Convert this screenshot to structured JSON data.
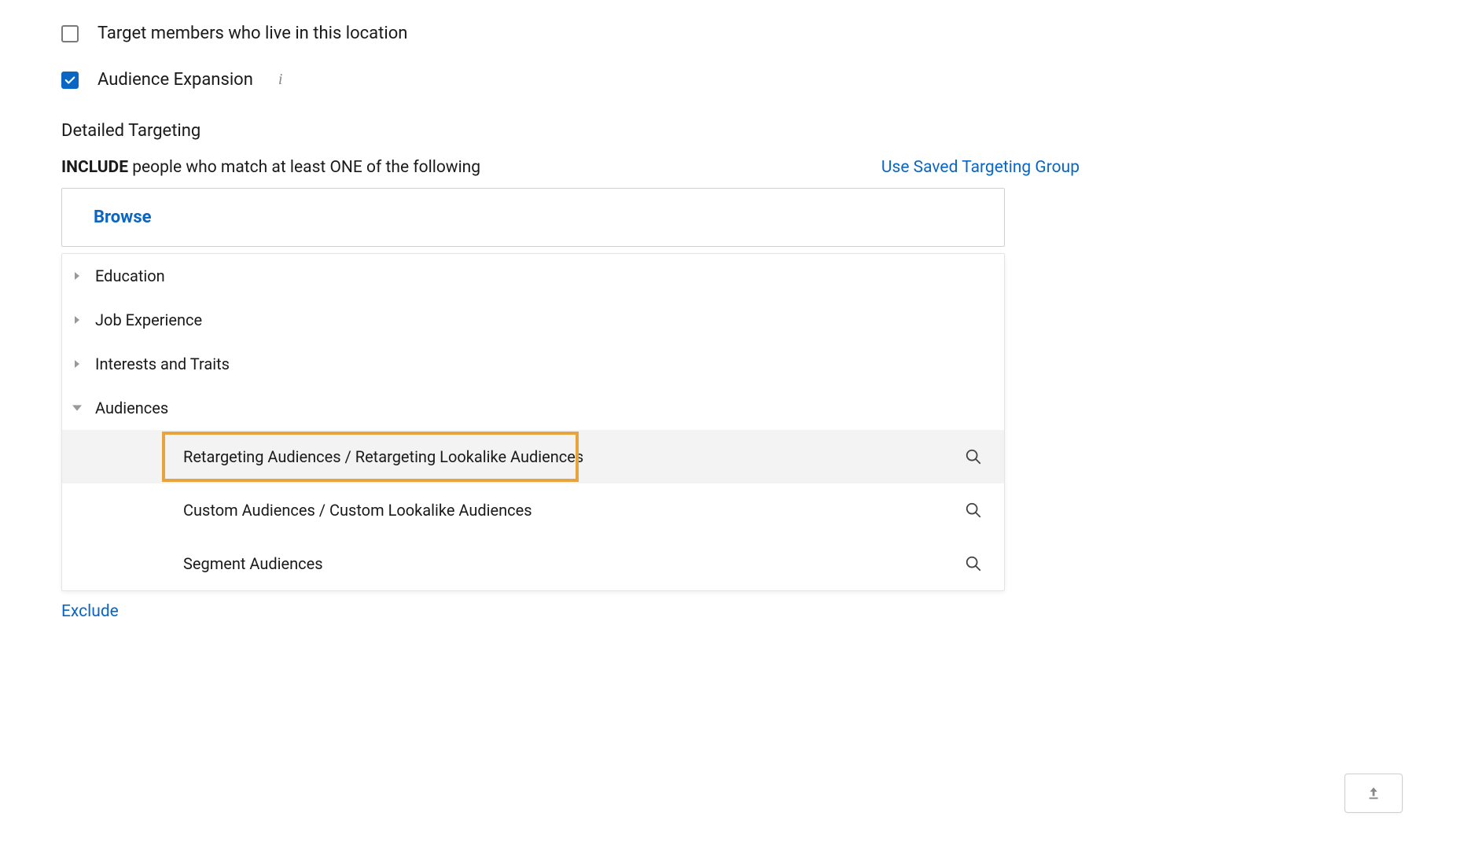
{
  "options": {
    "target_location_label": "Target members who live in this location",
    "target_location_checked": false,
    "audience_expansion_label": "Audience Expansion",
    "audience_expansion_checked": true
  },
  "detailed_targeting": {
    "heading": "Detailed Targeting",
    "include_bold": "INCLUDE",
    "include_rest": " people who match at least ONE of the following",
    "saved_group_link": "Use Saved Targeting Group",
    "browse_label": "Browse"
  },
  "tree": {
    "items": [
      {
        "label": "Education",
        "expanded": false
      },
      {
        "label": "Job Experience",
        "expanded": false
      },
      {
        "label": "Interests and Traits",
        "expanded": false
      },
      {
        "label": "Audiences",
        "expanded": true
      }
    ],
    "audiences_children": [
      {
        "label": "Retargeting Audiences / Retargeting Lookalike Audiences",
        "highlighted": true
      },
      {
        "label": "Custom Audiences / Custom Lookalike Audiences",
        "highlighted": false
      },
      {
        "label": "Segment Audiences",
        "highlighted": false
      }
    ]
  },
  "exclude_label": "Exclude"
}
